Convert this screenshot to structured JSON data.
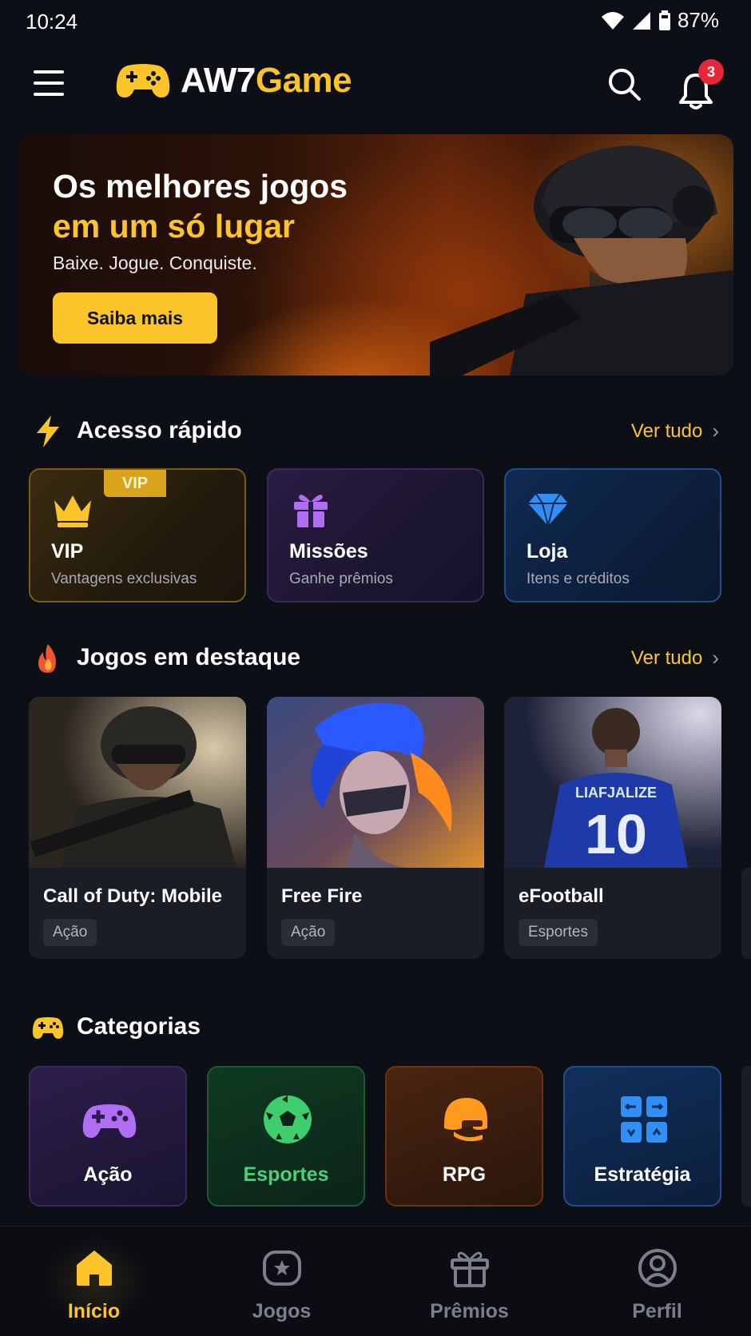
{
  "status_bar": {
    "time": "10:24",
    "battery": "87%"
  },
  "header": {
    "logo_prefix": "AW7",
    "logo_accent": "Game",
    "notification_count": "3"
  },
  "hero": {
    "title_line1": "Os melhores jogos",
    "title_line2": "em um só lugar",
    "subtitle": "Baixe. Jogue. Conquiste.",
    "button": "Saiba mais"
  },
  "quick_access": {
    "title": "Acesso rápido",
    "see_all": "Ver tudo",
    "items": [
      {
        "title": "VIP",
        "subtitle": "Vantagens exclusivas",
        "tag": "VIP",
        "icon": "crown-icon"
      },
      {
        "title": "Missões",
        "subtitle": "Ganhe prêmios",
        "icon": "gift-icon"
      },
      {
        "title": "Loja",
        "subtitle": "Itens e créditos",
        "icon": "diamond-icon"
      }
    ]
  },
  "featured": {
    "title": "Jogos em destaque",
    "see_all": "Ver tudo",
    "games": [
      {
        "name": "Call of Duty: Mobile",
        "category": "Ação"
      },
      {
        "name": "Free Fire",
        "category": "Ação"
      },
      {
        "name": "eFootball",
        "category": "Esportes",
        "jersey_text": "LIAFJALIZE",
        "jersey_number": "10"
      }
    ]
  },
  "categories": {
    "title": "Categorias",
    "items": [
      {
        "label": "Ação",
        "color": "#ffffff"
      },
      {
        "label": "Esportes",
        "color": "#49d17a"
      },
      {
        "label": "RPG",
        "color": "#ffffff"
      },
      {
        "label": "Estratégia",
        "color": "#ffffff"
      }
    ]
  },
  "bottom_nav": [
    {
      "label": "Início",
      "active": true
    },
    {
      "label": "Jogos",
      "active": false
    },
    {
      "label": "Prêmios",
      "active": false
    },
    {
      "label": "Perfil",
      "active": false
    }
  ],
  "colors": {
    "accent": "#fbc52a",
    "background": "#0d0f16",
    "badge": "#e6273a"
  }
}
